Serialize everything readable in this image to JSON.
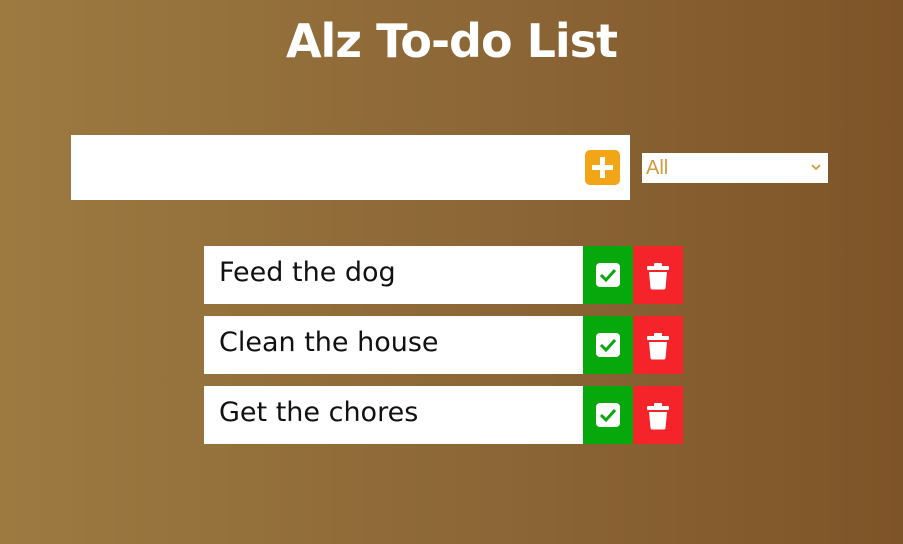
{
  "header": {
    "title": "Alz To-do List"
  },
  "add_form": {
    "input_value": "",
    "add_icon": "plus-square-icon",
    "accent_color": "#f2a516"
  },
  "filter": {
    "selected": "All",
    "text_color": "#d29a3d"
  },
  "todos": [
    {
      "text": "Feed the dog"
    },
    {
      "text": "Clean the house"
    },
    {
      "text": "Get the chores"
    }
  ],
  "actions": {
    "complete_icon": "check-square-icon",
    "complete_color": "#07a80b",
    "delete_icon": "trash-icon",
    "delete_color": "#f5232a"
  },
  "background": {
    "gradient_start": "#9c7a40",
    "gradient_end": "#7d5427"
  }
}
